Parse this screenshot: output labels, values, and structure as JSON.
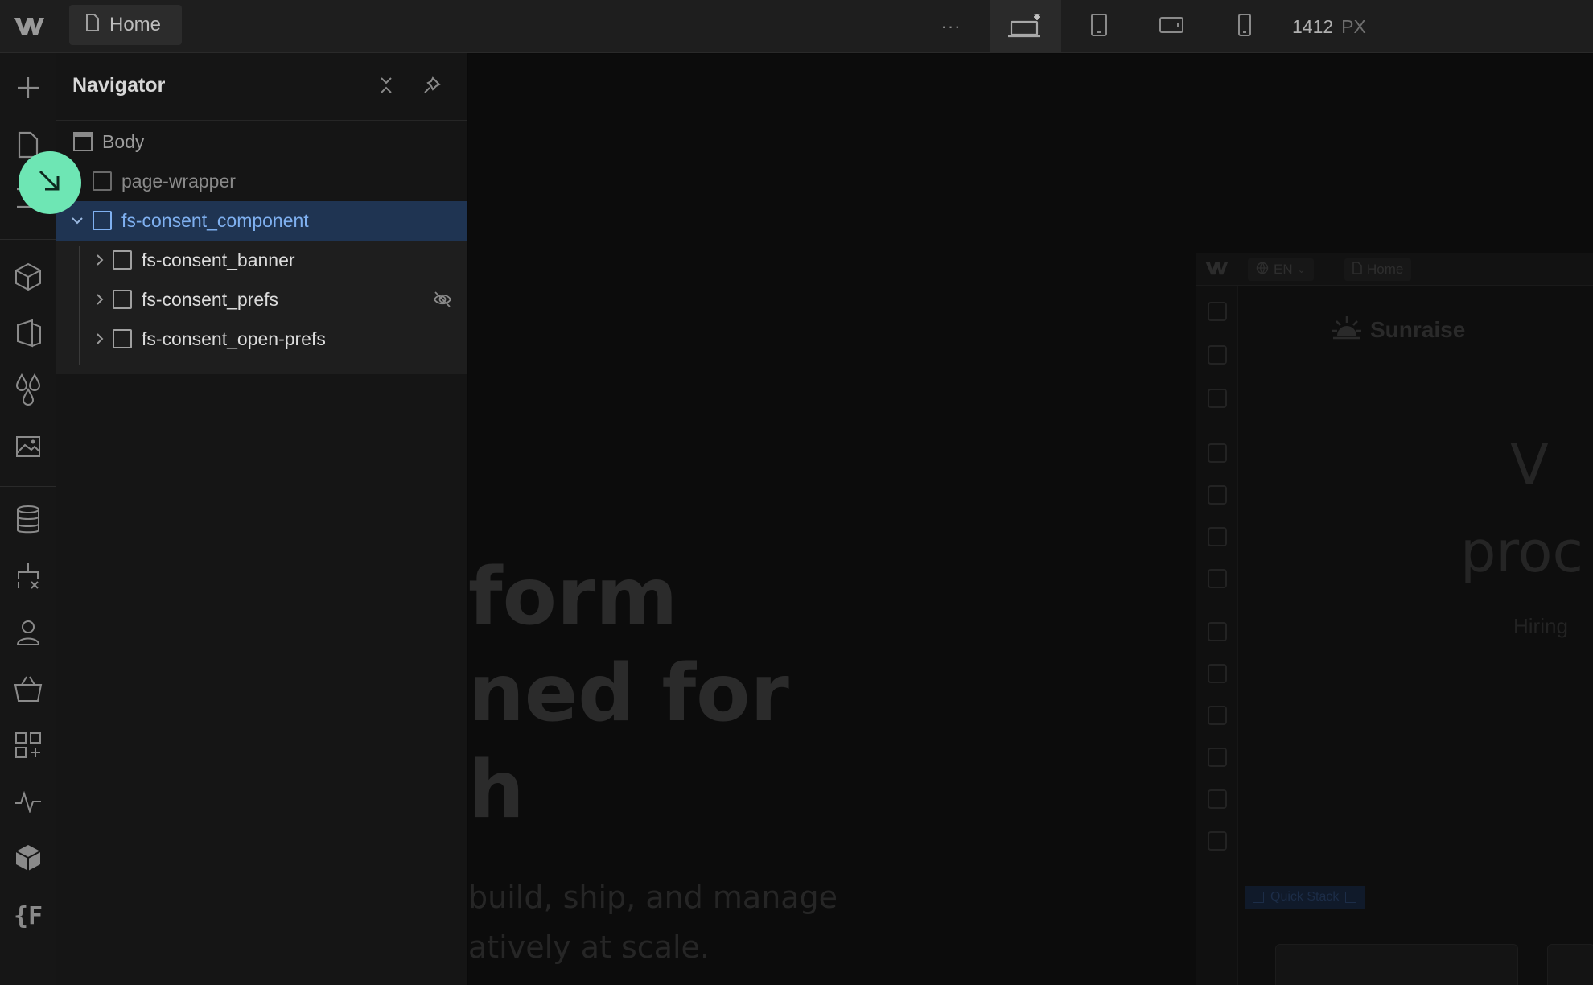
{
  "topbar": {
    "page_label": "Home",
    "more_label": "···",
    "width_value": "1412",
    "width_unit": "PX",
    "breakpoints": [
      "desktop-base",
      "tablet",
      "mobile-landscape",
      "mobile-portrait"
    ]
  },
  "rail": {
    "icons": [
      "add-icon",
      "pages-icon",
      "navigator-icon",
      "components-icon",
      "variables-icon",
      "styles-icon",
      "assets-icon",
      "cms-icon",
      "logic-icon",
      "users-icon",
      "ecommerce-icon",
      "apps-icon",
      "audit-icon",
      "cube-icon",
      "code-icon"
    ]
  },
  "navigator": {
    "title": "Navigator",
    "tree": [
      {
        "label": "Body",
        "depth": 0,
        "expandable": false,
        "selected": false,
        "hidden": false
      },
      {
        "label": "page-wrapper",
        "depth": 1,
        "expandable": false,
        "selected": false,
        "hidden": false
      },
      {
        "label": "fs-consent_component",
        "depth": 1,
        "expandable": true,
        "expanded": true,
        "selected": true,
        "hidden": false
      },
      {
        "label": "fs-consent_banner",
        "depth": 2,
        "expandable": true,
        "selected": false,
        "hidden": false
      },
      {
        "label": "fs-consent_prefs",
        "depth": 2,
        "expandable": true,
        "selected": false,
        "hidden": true
      },
      {
        "label": "fs-consent_open-prefs",
        "depth": 2,
        "expandable": true,
        "selected": false,
        "hidden": false
      }
    ]
  },
  "canvas": {
    "hero_lines": [
      "form",
      "ned for",
      "h"
    ],
    "hero_sub_lines": [
      "build, ship, and manage",
      "atively at scale."
    ],
    "preview": {
      "lang": "EN",
      "page": "Home",
      "brand": "Sunraise",
      "big_text_1": "V",
      "big_text_2": "proc",
      "hiring": "Hiring",
      "quick_stack": "Quick Stack"
    }
  },
  "colors": {
    "accent_selected_bg": "#1f3452",
    "accent_selected_text": "#7fb0f0",
    "cursor_highlight": "#6ee6b4"
  }
}
